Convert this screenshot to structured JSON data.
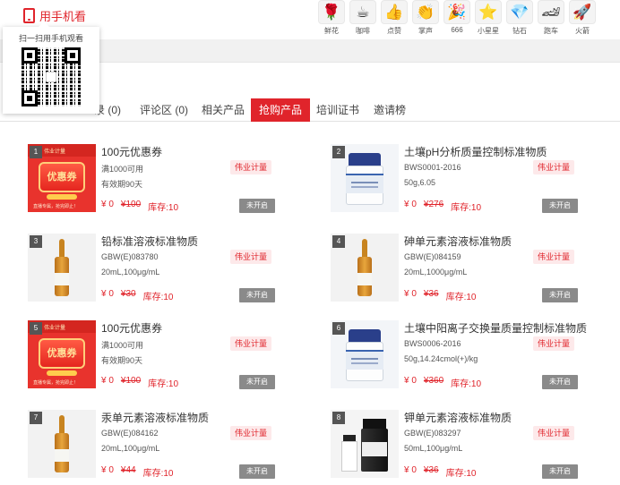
{
  "header": {
    "mobile_view_label": "用手机看",
    "gifts": [
      {
        "label": "鲜花",
        "icon": "rose-icon",
        "glyph": "🌹"
      },
      {
        "label": "咖啡",
        "icon": "coffee-icon",
        "glyph": "☕"
      },
      {
        "label": "点赞",
        "icon": "thumbs-up-icon",
        "glyph": "👍"
      },
      {
        "label": "掌声",
        "icon": "clapping-icon",
        "glyph": "👏"
      },
      {
        "label": "666",
        "icon": "666-icon",
        "glyph": "🎉"
      },
      {
        "label": "小星星",
        "icon": "star-icon",
        "glyph": "⭐"
      },
      {
        "label": "钻石",
        "icon": "diamond-icon",
        "glyph": "💎"
      },
      {
        "label": "跑车",
        "icon": "sports-car-icon",
        "glyph": "🏎"
      },
      {
        "label": "火箭",
        "icon": "rocket-icon",
        "glyph": "🚀"
      }
    ]
  },
  "qr_popup": {
    "title": "扫一扫用手机观看"
  },
  "tabs": [
    {
      "label": "录 (0)"
    },
    {
      "label": "评论区 (0)"
    },
    {
      "label": "相关产品"
    },
    {
      "label": "抢购产品",
      "active": true
    },
    {
      "label": "培训证书"
    },
    {
      "label": "邀请榜"
    }
  ],
  "products": [
    {
      "index": "1",
      "image": "coupon",
      "title": "100元优惠券",
      "line1": "满1000可用",
      "line2": "有效期90天",
      "brand": "伟业计量",
      "price": "¥ 0",
      "old_price": "¥100",
      "stock": "库存:10",
      "status": "未开启"
    },
    {
      "index": "2",
      "image": "jar",
      "title": "土壤pH分析质量控制标准物质",
      "line1": "BWS0001-2016",
      "line2": "50g,6.05",
      "brand": "伟业计量",
      "price": "¥ 0",
      "old_price": "¥276",
      "stock": "库存:10",
      "status": "未开启"
    },
    {
      "index": "3",
      "image": "ampoule",
      "title": "铅标准溶液标准物质",
      "line1": "GBW(E)083780",
      "line2": "20mL,100μg/mL",
      "brand": "伟业计量",
      "price": "¥ 0",
      "old_price": "¥30",
      "stock": "库存:10",
      "status": "未开启"
    },
    {
      "index": "4",
      "image": "ampoule",
      "title": "砷单元素溶液标准物质",
      "line1": "GBW(E)084159",
      "line2": "20mL,1000μg/mL",
      "brand": "伟业计量",
      "price": "¥ 0",
      "old_price": "¥36",
      "stock": "库存:10",
      "status": "未开启"
    },
    {
      "index": "5",
      "image": "coupon",
      "title": "100元优惠券",
      "line1": "满1000可用",
      "line2": "有效期90天",
      "brand": "伟业计量",
      "price": "¥ 0",
      "old_price": "¥100",
      "stock": "库存:10",
      "status": "未开启"
    },
    {
      "index": "6",
      "image": "jar",
      "title": "土壤中阳离子交换量质量控制标准物质",
      "line1": "BWS0006-2016",
      "line2": "50g,14.24cmol(+)/kg",
      "brand": "伟业计量",
      "price": "¥ 0",
      "old_price": "¥360",
      "stock": "库存:10",
      "status": "未开启"
    },
    {
      "index": "7",
      "image": "ampoule",
      "title": "汞单元素溶液标准物质",
      "line1": "GBW(E)084162",
      "line2": "20mL,100μg/mL",
      "brand": "伟业计量",
      "price": "¥ 0",
      "old_price": "¥44",
      "stock": "库存:10",
      "status": "未开启"
    },
    {
      "index": "8",
      "image": "duo",
      "title": "钾单元素溶液标准物质",
      "line1": "GBW(E)083297",
      "line2": "50mL,100μg/mL",
      "brand": "伟业计量",
      "price": "¥ 0",
      "old_price": "¥36",
      "stock": "库存:10",
      "status": "未开启"
    }
  ],
  "coupon_art": {
    "brand": "伟业计量",
    "word": "优惠券",
    "footer": "直播专属，抢完即止！"
  },
  "colors": {
    "accent": "#e0242b",
    "status_disabled": "#8a8a8a"
  }
}
